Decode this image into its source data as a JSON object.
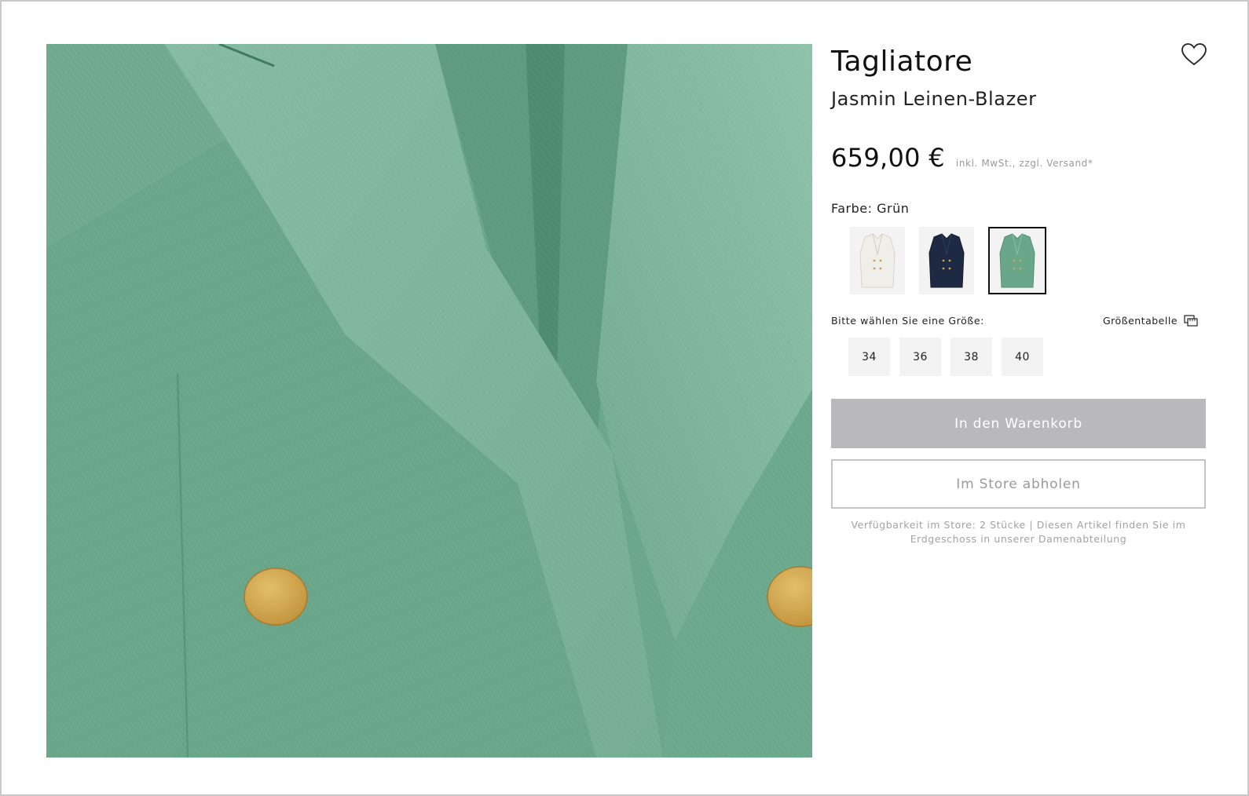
{
  "product": {
    "brand": "Tagliatore",
    "name": "Jasmin Leinen-Blazer",
    "price": "659,00 €",
    "tax_note": "inkl. MwSt., zzgl. Versand*",
    "image_main_color": "#6aa68a",
    "button_color": "#d2a64e"
  },
  "wishlist": {
    "icon": "heart-icon"
  },
  "color": {
    "label": "Farbe: Grün",
    "options": [
      {
        "name": "white",
        "color": "#f0eee8",
        "selected": false
      },
      {
        "name": "navy",
        "color": "#1e2a44",
        "selected": false
      },
      {
        "name": "green",
        "color": "#6aa68a",
        "selected": true
      }
    ]
  },
  "size": {
    "label": "Bitte wählen Sie eine Größe:",
    "chart_label": "Größentabelle",
    "options": [
      "34",
      "36",
      "38",
      "40"
    ]
  },
  "actions": {
    "cart_label": "In den Warenkorb",
    "store_label": "Im Store abholen"
  },
  "availability": "Verfügbarkeit im Store: 2 Stücke | Diesen Artikel finden Sie im Erdgeschoss in unserer Damenabteilung"
}
